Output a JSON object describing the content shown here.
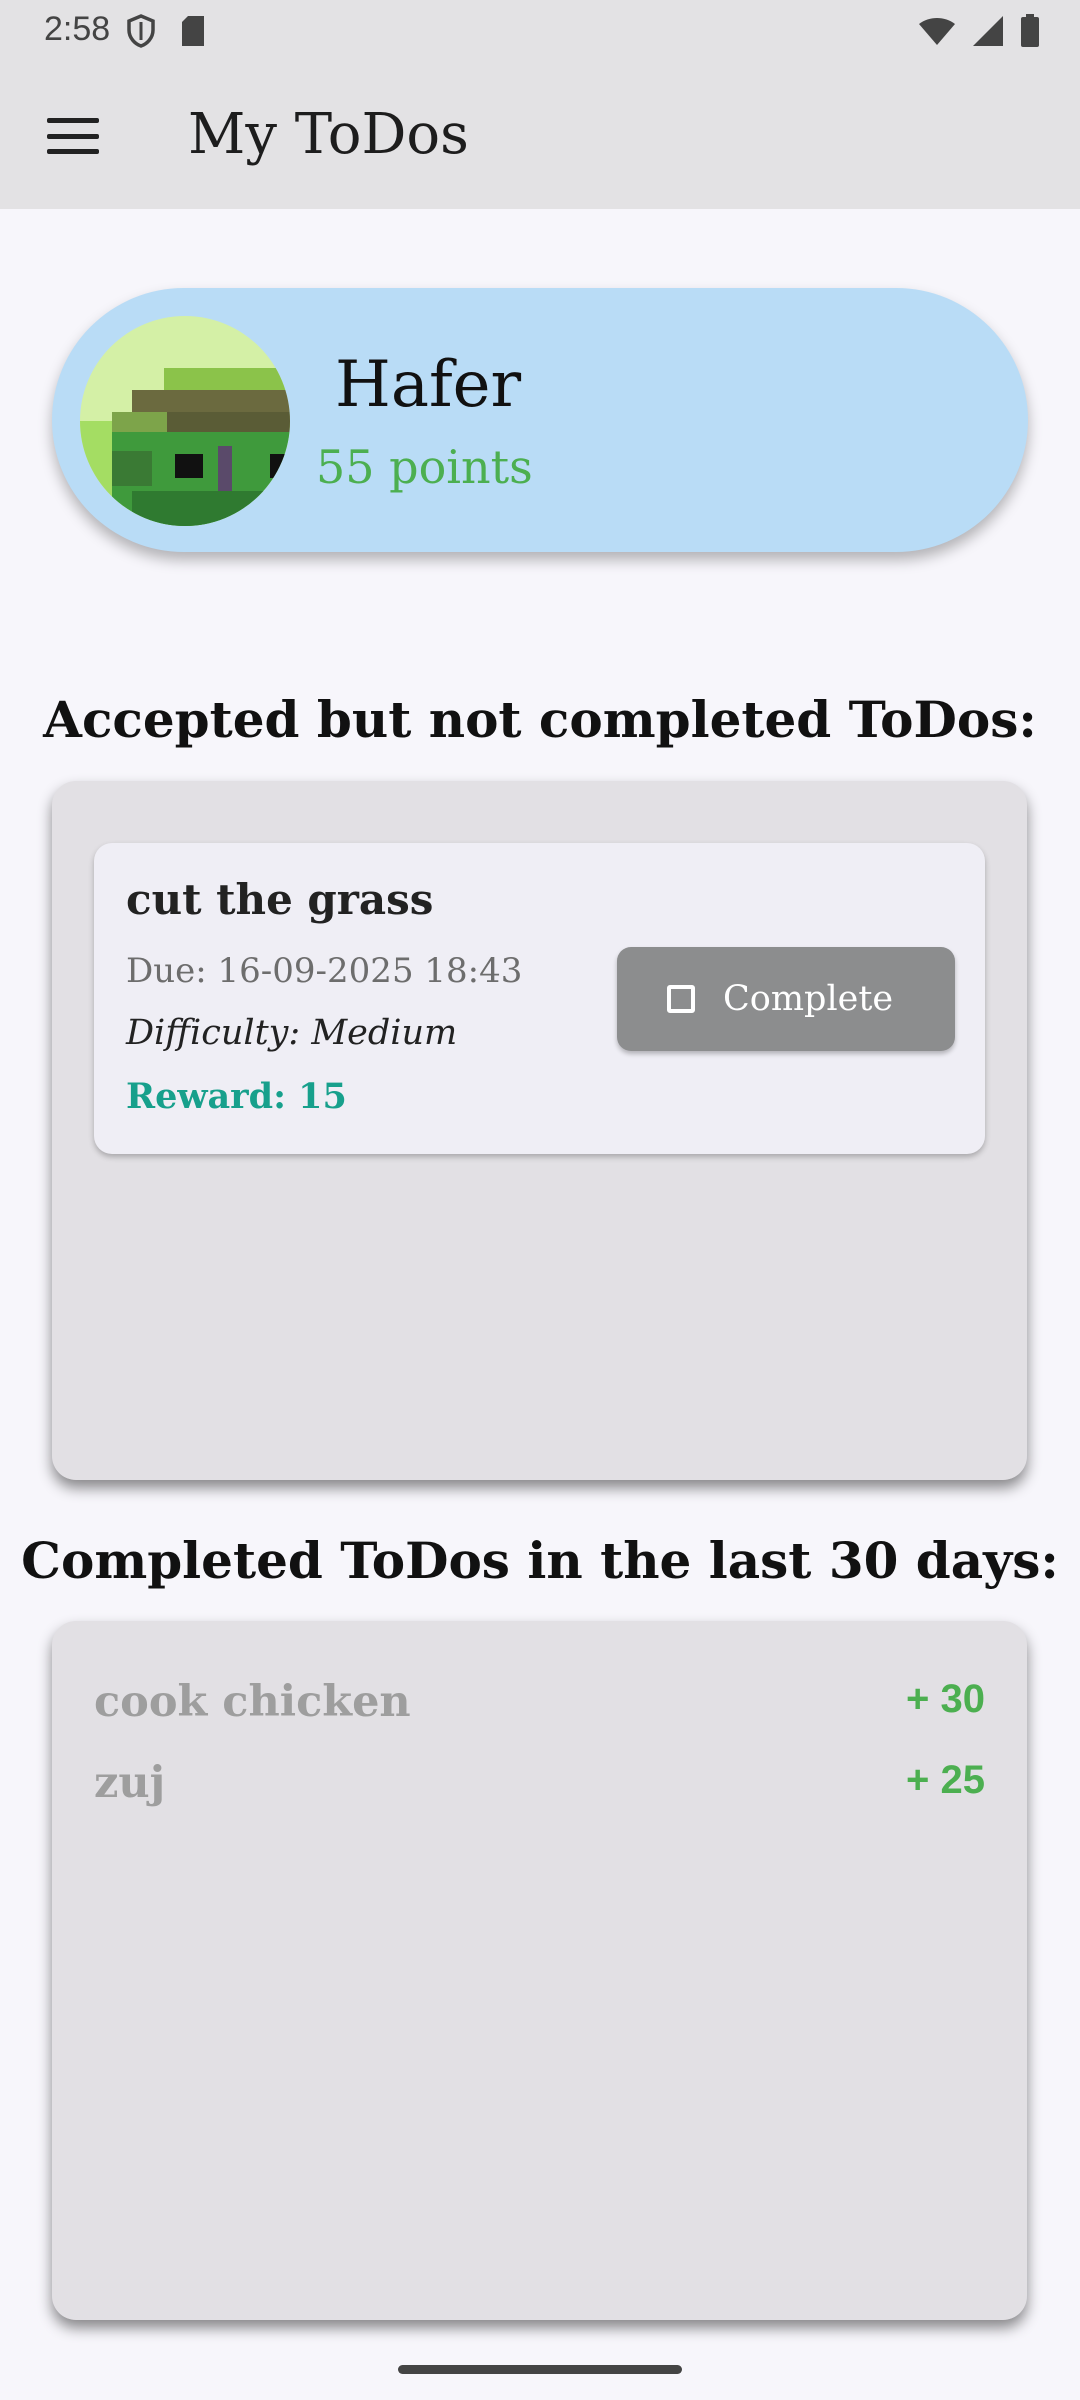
{
  "status_bar": {
    "time": "2:58",
    "left_icons": [
      "shield-icon",
      "sim-card-icon"
    ],
    "right_icons": [
      "wifi-icon",
      "signal-icon",
      "battery-icon"
    ]
  },
  "app_bar": {
    "menu_icon": "menu-icon",
    "title": "My ToDos"
  },
  "profile": {
    "name": "Hafer",
    "points": "55 points"
  },
  "accepted_section": {
    "title": "Accepted but not completed ToDos:",
    "todos": [
      {
        "title": "cut the grass",
        "due": "Due: 16-09-2025 18:43",
        "difficulty": "Difficulty: Medium",
        "reward": "Reward: 15",
        "action_label": "Complete"
      }
    ]
  },
  "completed_section": {
    "title": "Completed ToDos in the last 30 days:",
    "items": [
      {
        "name": "cook chicken",
        "points": "+ 30"
      },
      {
        "name": "zuj",
        "points": "+ 25"
      }
    ]
  },
  "colors": {
    "app_bar_bg": "#e3e2e4",
    "profile_bg": "#b9dcf6",
    "points_green": "#4caf50",
    "reward_teal": "#17a08c",
    "button_gray": "#8c8d8e"
  }
}
